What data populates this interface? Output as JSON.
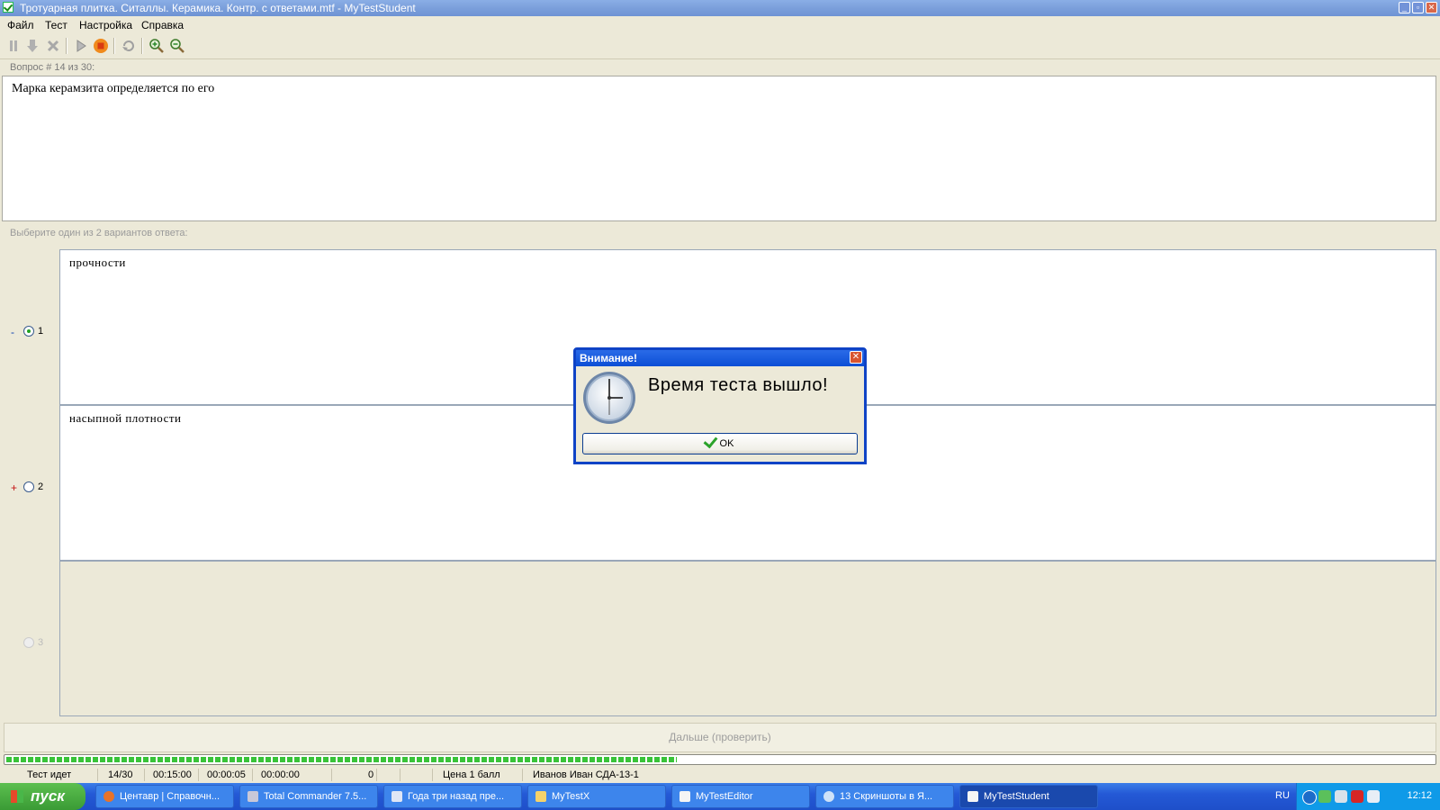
{
  "window": {
    "title": "Тротуарная плитка. Ситаллы. Керамика. Контр. с ответами.mtf - MyTestStudent"
  },
  "menu": [
    "Файл",
    "Тест",
    "Настройка",
    "Справка"
  ],
  "toolbar_icons": [
    "pause-icon",
    "down-icon",
    "cancel-icon",
    "play-icon",
    "stop-icon",
    "refresh-icon",
    "zoom-in-icon",
    "zoom-out-icon"
  ],
  "question": {
    "header": "Вопрос # 14 из 30:",
    "text": "Марка керамзита определяется по его"
  },
  "answers": {
    "header": "Выберите один из 2 вариантов ответа:",
    "options": [
      {
        "marker": "-",
        "number": "1",
        "text": "прочности",
        "selected": true
      },
      {
        "marker": "+",
        "number": "2",
        "text": "насыпной плотности",
        "selected": false
      },
      {
        "marker": "",
        "number": "3",
        "text": "",
        "selected": false,
        "disabled": true
      }
    ]
  },
  "next_button": "Дальше (проверить)",
  "progress": 0.47,
  "status": {
    "state": "Тест идет",
    "count": "14/30",
    "time_total": "00:15:00",
    "time_used": "00:00:05",
    "time_left": "00:00:00",
    "score": "0",
    "price": "Цена 1 балл",
    "student": "Иванов Иван СДА-13-1"
  },
  "dialog": {
    "title": "Внимание!",
    "message": "Время теста вышло!",
    "ok": "OK"
  },
  "taskbar": {
    "start": "пуск",
    "tasks": [
      "Центавр | Справочн...",
      "Total Commander 7.5...",
      "Года три назад пре...",
      "MyTestX",
      "MyTestEditor",
      "13 Скриншоты в Я...",
      "MyTestStudent"
    ],
    "lang": "RU",
    "clock": "12:12"
  },
  "colors": {
    "titlebar": "#7B9FDB",
    "dialog_border": "#0f43c6",
    "progress": "#39c339",
    "plus_marker": "#c41010",
    "minus_marker": "#0b3fb0"
  }
}
